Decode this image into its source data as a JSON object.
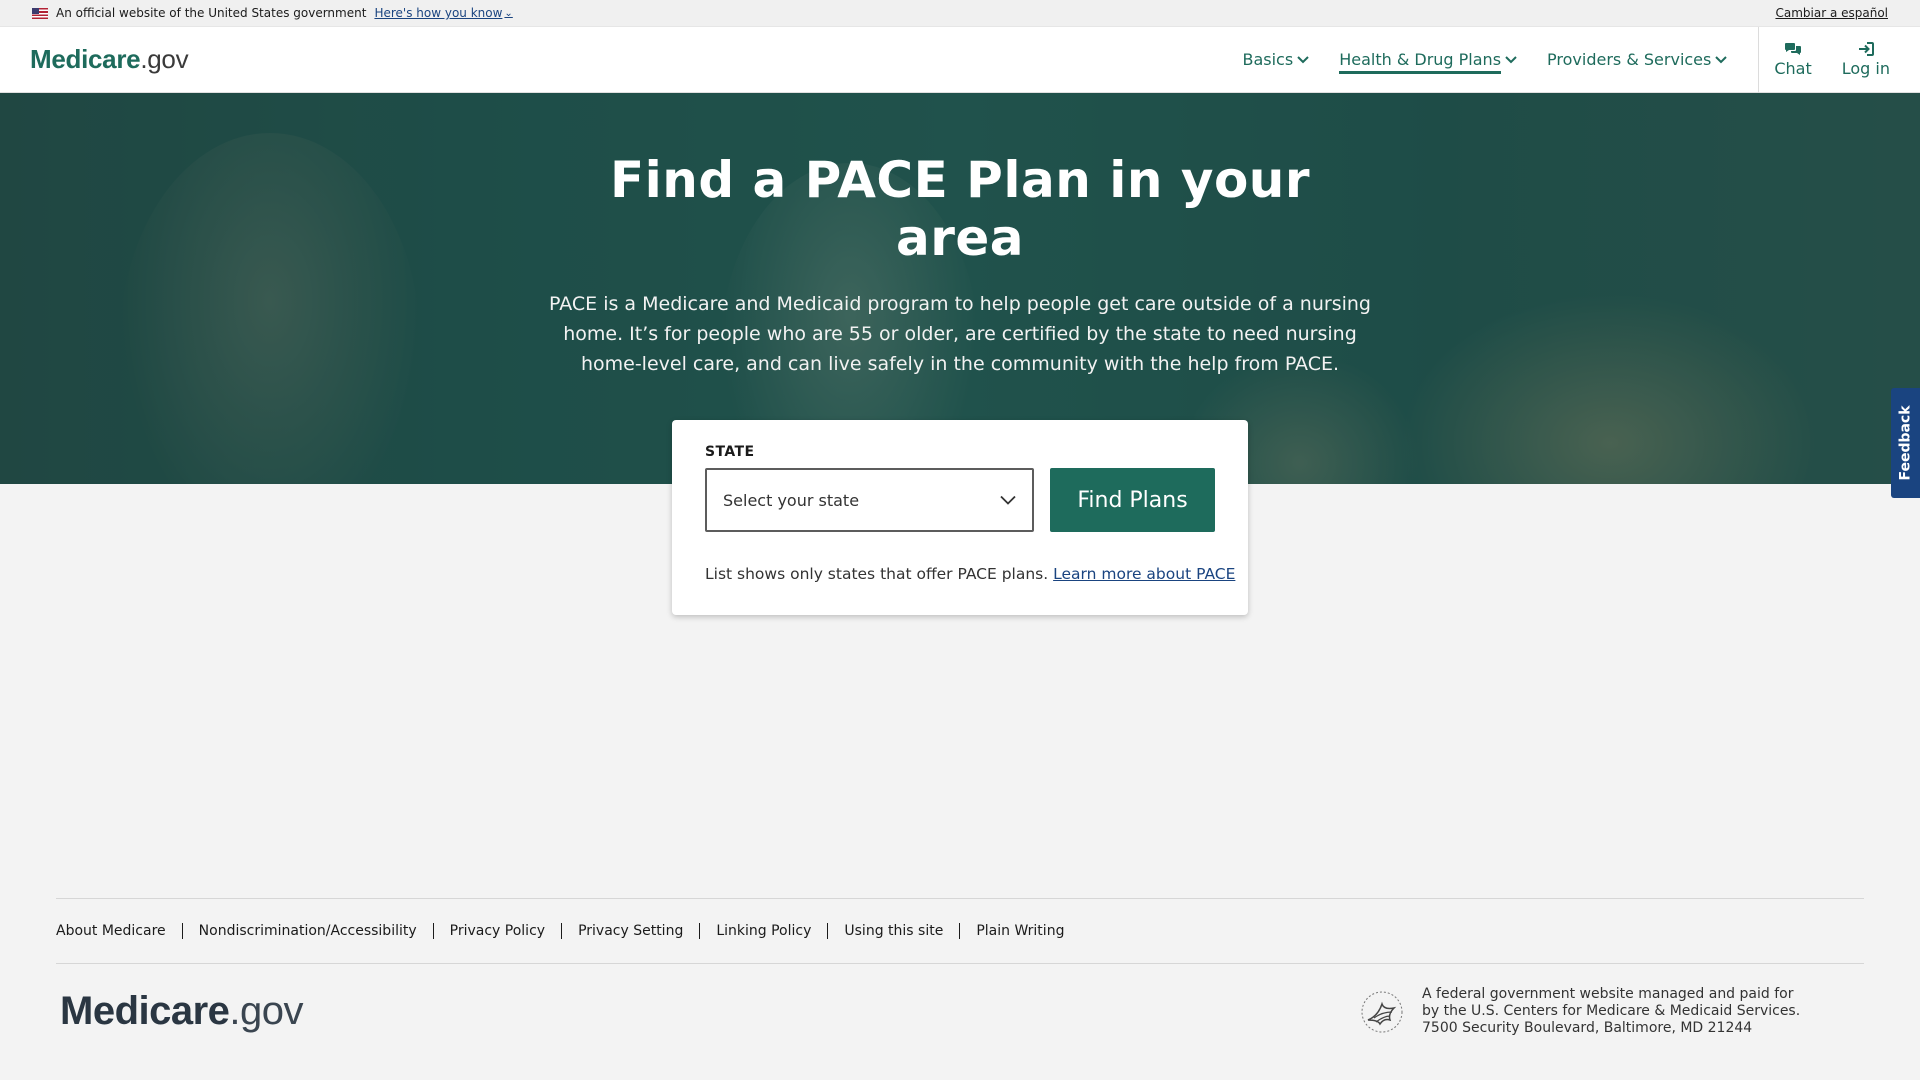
{
  "gov_banner": {
    "official_text": "An official website of the United States government",
    "how_you_know": "Here's how you know",
    "spanish_link": "Cambiar a español"
  },
  "header": {
    "logo_main": "Medicare",
    "logo_suffix": ".gov",
    "nav": [
      {
        "label": "Basics",
        "active": false
      },
      {
        "label": "Health & Drug Plans",
        "active": true
      },
      {
        "label": "Providers & Services",
        "active": false
      }
    ],
    "chat_label": "Chat",
    "login_label": "Log in"
  },
  "hero": {
    "title": "Find a PACE Plan in your area",
    "description": "PACE is a Medicare and Medicaid program to help people get care outside of a nursing home. It’s for people who are 55 or older, are certified by the state to need nursing home-level care, and can live safely in the community with the help from PACE."
  },
  "search": {
    "state_label": "STATE",
    "select_placeholder": "Select your state",
    "find_button": "Find Plans",
    "note": "List shows only states that offer PACE plans.",
    "learn_more": "Learn more about PACE"
  },
  "feedback_label": "Feedback",
  "footer": {
    "links": [
      "About Medicare",
      "Nondiscrimination/Accessibility",
      "Privacy Policy",
      "Privacy Setting",
      "Linking Policy",
      "Using this site",
      "Plain Writing"
    ],
    "logo_main": "Medicare",
    "logo_suffix": ".gov",
    "hhs_line1": "A federal government website managed and paid for",
    "hhs_line2": "by the U.S. Centers for Medicare & Medicaid Services.",
    "hhs_line3": "7500 Security Boulevard, Baltimore, MD 21244"
  },
  "colors": {
    "brand_green": "#1e6b5c",
    "link_blue": "#1a4480",
    "feedback_blue": "#1a4480"
  }
}
